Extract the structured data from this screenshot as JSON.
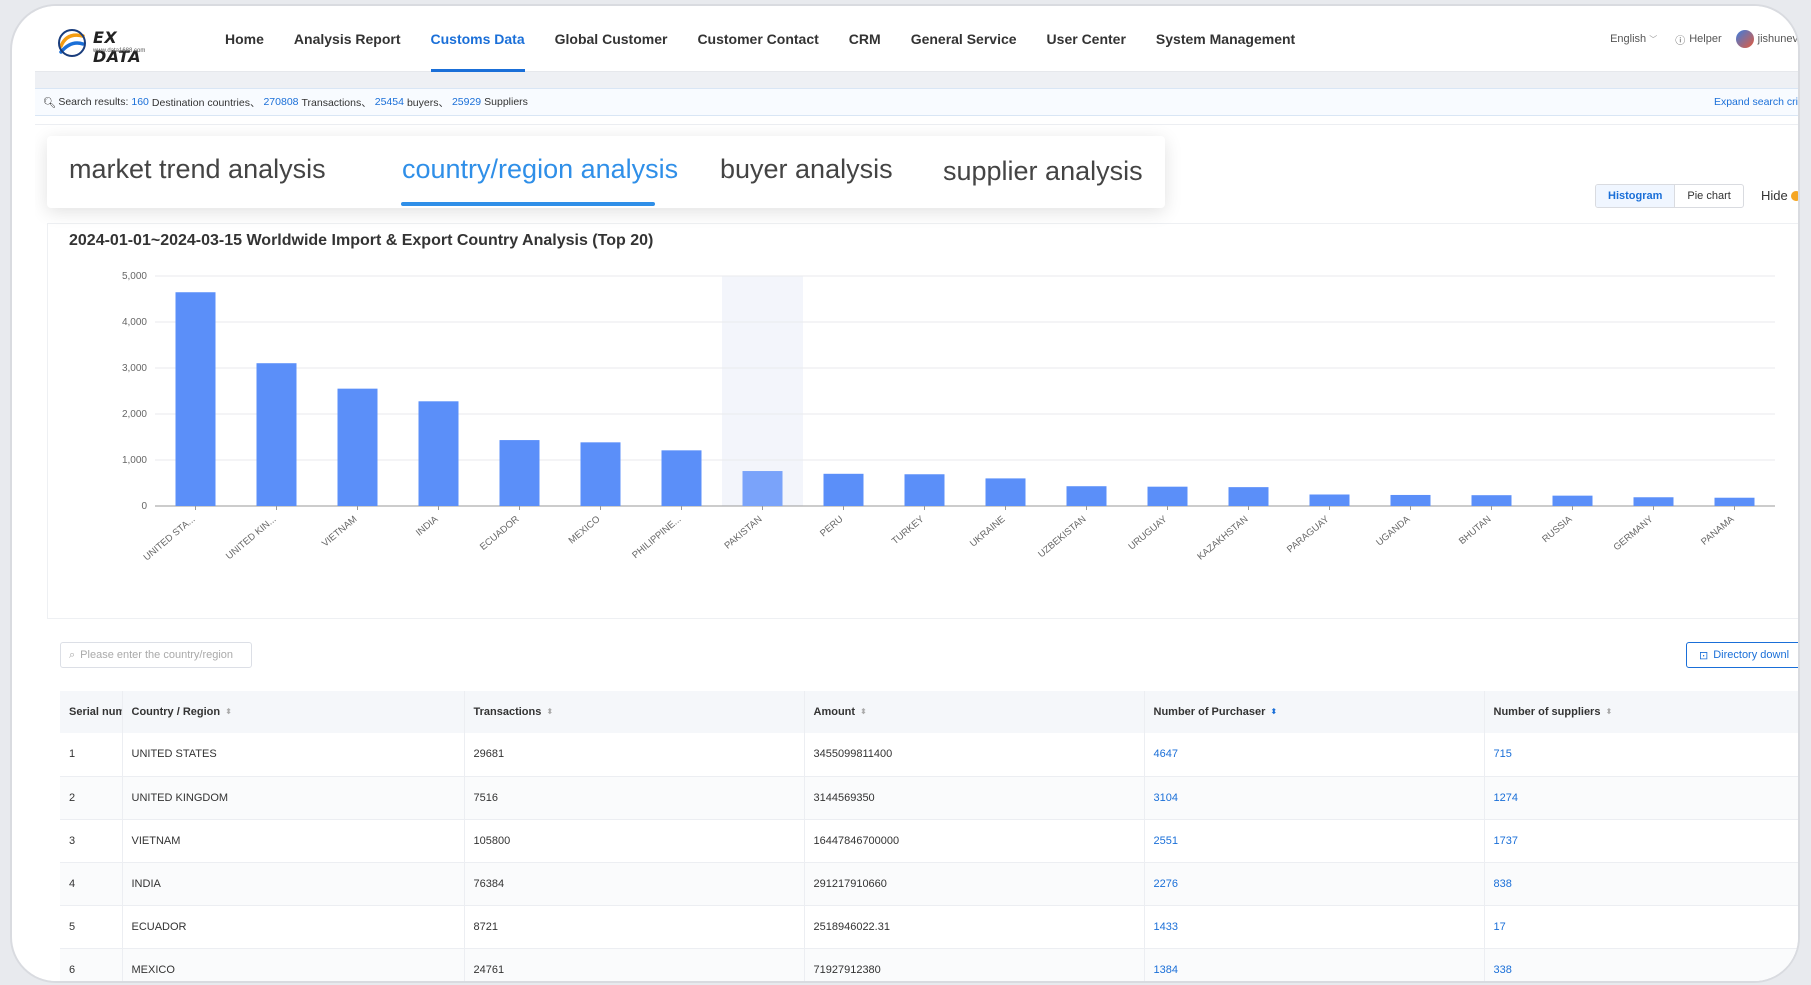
{
  "brand": {
    "name": "EX DATA",
    "subtitle": "www.data1688.com"
  },
  "nav": {
    "items": [
      "Home",
      "Analysis Report",
      "Customs Data",
      "Global Customer",
      "Customer Contact",
      "CRM",
      "General Service",
      "User Center",
      "System Management"
    ],
    "active_index": 2,
    "language": "English",
    "helper": "Helper",
    "user": "jishunev"
  },
  "search_summary": {
    "prefix": "Search results:",
    "countries": "160",
    "countries_label": "Destination countries、",
    "transactions": "270808",
    "transactions_label": "Transactions、",
    "buyers": "25454",
    "buyers_label": "buyers、",
    "suppliers": "25929",
    "suppliers_label": "Suppliers",
    "expand": "Expand search cri"
  },
  "analysis_tabs": [
    "market trend analysis",
    "country/region analysis",
    "buyer analysis",
    "supplier analysis"
  ],
  "chart_toggle": {
    "histogram": "Histogram",
    "pie": "Pie chart",
    "hide": "Hide"
  },
  "chart_data": {
    "type": "bar",
    "title": "2024-01-01~2024-03-15 Worldwide Import & Export Country Analysis (Top 20)",
    "categories": [
      "UNITED STA...",
      "UNITED KIN...",
      "VIETNAM",
      "INDIA",
      "ECUADOR",
      "MEXICO",
      "PHILIPPINE...",
      "PAKISTAN",
      "PERU",
      "TURKEY",
      "UKRAINE",
      "UZBEKISTAN",
      "URUGUAY",
      "KAZAKHSTAN",
      "PARAGUAY",
      "UGANDA",
      "BHUTAN",
      "RUSSIA",
      "GERMANY",
      "PANAMA"
    ],
    "values": [
      4647,
      3104,
      2551,
      2276,
      1433,
      1384,
      1210,
      760,
      700,
      690,
      600,
      430,
      420,
      410,
      250,
      240,
      235,
      225,
      190,
      180
    ],
    "ylim": [
      0,
      5000
    ],
    "yticks": [
      "0",
      "1,000",
      "2,000",
      "3,000",
      "4,000",
      "5,000"
    ],
    "highlight_index": 7,
    "bar_color": "#5b8ff9",
    "grid": true
  },
  "table": {
    "search_placeholder": "Please enter the country/region",
    "download": "Directory downl",
    "headers": [
      "Serial num",
      "Country / Region",
      "Transactions",
      "Amount",
      "Number of Purchaser",
      "Number of suppliers"
    ],
    "rows": [
      [
        "1",
        "UNITED STATES",
        "29681",
        "3455099811400",
        "4647",
        "715"
      ],
      [
        "2",
        "UNITED KINGDOM",
        "7516",
        "3144569350",
        "3104",
        "1274"
      ],
      [
        "3",
        "VIETNAM",
        "105800",
        "16447846700000",
        "2551",
        "1737"
      ],
      [
        "4",
        "INDIA",
        "76384",
        "291217910660",
        "2276",
        "838"
      ],
      [
        "5",
        "ECUADOR",
        "8721",
        "2518946022.31",
        "1433",
        "17"
      ],
      [
        "6",
        "MEXICO",
        "24761",
        "71927912380",
        "1384",
        "338"
      ]
    ]
  },
  "colors": {
    "accent": "#1a6fd8",
    "tab_accent": "#2f8fe8",
    "bar": "#5b8ff9"
  }
}
